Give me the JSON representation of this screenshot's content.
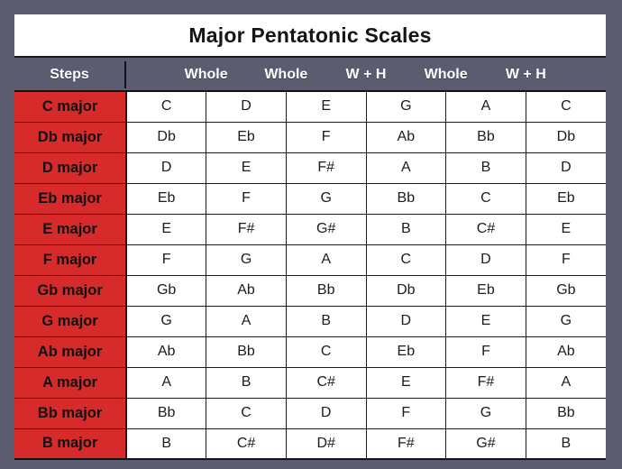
{
  "title": "Major Pentatonic Scales",
  "colors": {
    "background": "#5c5c70",
    "scale_name_red": "#d72a2a",
    "grid_line": "#1c1c1c",
    "title_text": "#141414",
    "header_text": "#ffffff"
  },
  "header": {
    "steps_label": "Steps",
    "steps": [
      "Whole",
      "Whole",
      "W + H",
      "Whole",
      "W + H"
    ]
  },
  "table": {
    "rows": [
      {
        "scale": "C major",
        "notes": [
          "C",
          "D",
          "E",
          "G",
          "A",
          "C"
        ]
      },
      {
        "scale": "Db major",
        "notes": [
          "Db",
          "Eb",
          "F",
          "Ab",
          "Bb",
          "Db"
        ]
      },
      {
        "scale": "D major",
        "notes": [
          "D",
          "E",
          "F#",
          "A",
          "B",
          "D"
        ]
      },
      {
        "scale": "Eb major",
        "notes": [
          "Eb",
          "F",
          "G",
          "Bb",
          "C",
          "Eb"
        ]
      },
      {
        "scale": "E major",
        "notes": [
          "E",
          "F#",
          "G#",
          "B",
          "C#",
          "E"
        ]
      },
      {
        "scale": "F major",
        "notes": [
          "F",
          "G",
          "A",
          "C",
          "D",
          "F"
        ]
      },
      {
        "scale": "Gb major",
        "notes": [
          "Gb",
          "Ab",
          "Bb",
          "Db",
          "Eb",
          "Gb"
        ]
      },
      {
        "scale": "G major",
        "notes": [
          "G",
          "A",
          "B",
          "D",
          "E",
          "G"
        ]
      },
      {
        "scale": "Ab major",
        "notes": [
          "Ab",
          "Bb",
          "C",
          "Eb",
          "F",
          "Ab"
        ]
      },
      {
        "scale": "A major",
        "notes": [
          "A",
          "B",
          "C#",
          "E",
          "F#",
          "A"
        ]
      },
      {
        "scale": "Bb major",
        "notes": [
          "Bb",
          "C",
          "D",
          "F",
          "G",
          "Bb"
        ]
      },
      {
        "scale": "B major",
        "notes": [
          "B",
          "C#",
          "D#",
          "F#",
          "G#",
          "B"
        ]
      }
    ]
  }
}
